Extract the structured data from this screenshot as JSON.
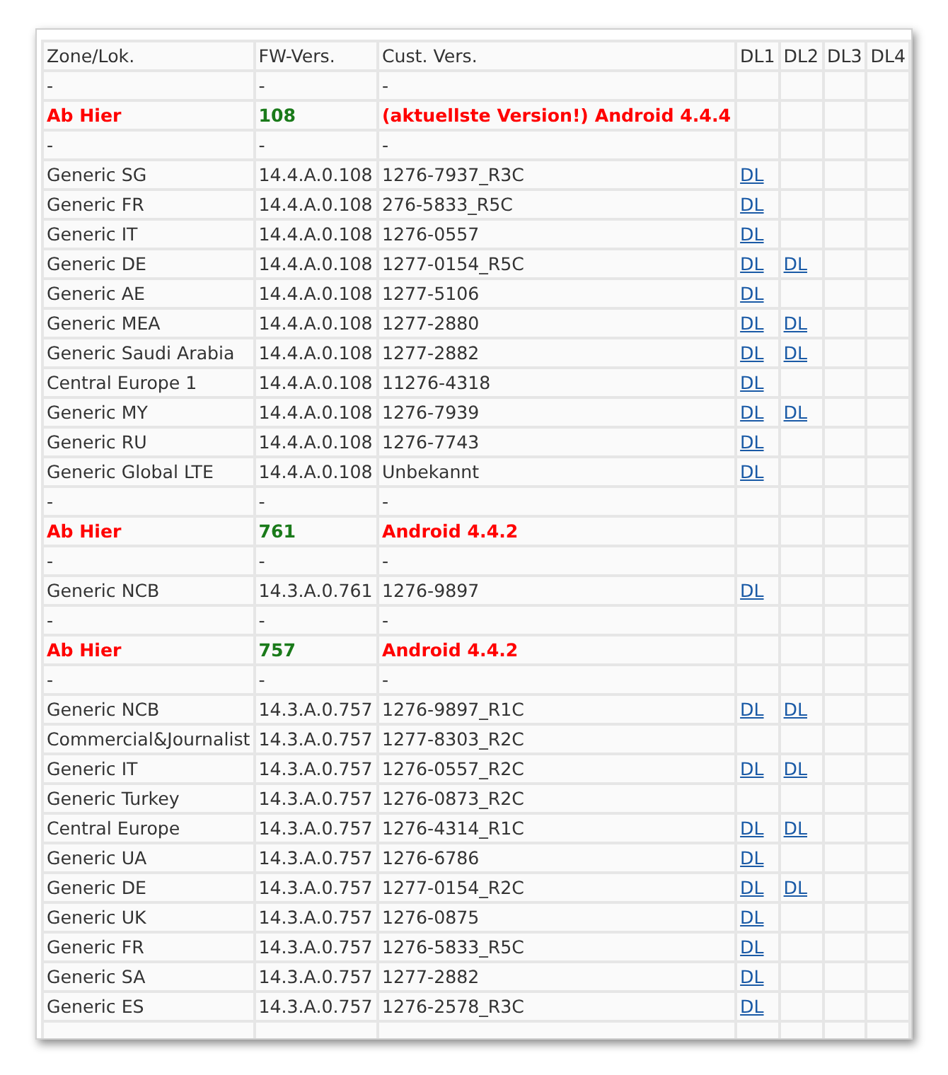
{
  "table": {
    "columns": [
      "Zone/Lok.",
      "FW-Vers.",
      "Cust. Vers.",
      "DL1",
      "DL2",
      "DL3",
      "DL4"
    ],
    "rows": [
      {
        "kind": "separator",
        "cells": [
          "-",
          "-",
          "-"
        ]
      },
      {
        "kind": "section",
        "cells": [
          "Ab Hier",
          "108",
          "(aktuellste Version!) Android 4.4.4"
        ]
      },
      {
        "kind": "separator",
        "cells": [
          "-",
          "-",
          "-"
        ]
      },
      {
        "kind": "data",
        "cells": [
          "Generic SG",
          "14.4.A.0.108",
          "1276-7937_R3C"
        ],
        "downloads": [
          "DL"
        ]
      },
      {
        "kind": "data",
        "cells": [
          "Generic FR",
          "14.4.A.0.108",
          "276-5833_R5C"
        ],
        "downloads": [
          "DL"
        ]
      },
      {
        "kind": "data",
        "cells": [
          "Generic IT",
          "14.4.A.0.108",
          "1276-0557"
        ],
        "downloads": [
          "DL"
        ]
      },
      {
        "kind": "data",
        "cells": [
          "Generic DE",
          "14.4.A.0.108",
          "1277-0154_R5C"
        ],
        "downloads": [
          "DL",
          "DL"
        ]
      },
      {
        "kind": "data",
        "cells": [
          "Generic AE",
          "14.4.A.0.108",
          "1277-5106"
        ],
        "downloads": [
          "DL"
        ]
      },
      {
        "kind": "data",
        "cells": [
          "Generic MEA",
          "14.4.A.0.108",
          "1277-2880"
        ],
        "downloads": [
          "DL",
          "DL"
        ]
      },
      {
        "kind": "data",
        "cells": [
          "Generic Saudi Arabia",
          "14.4.A.0.108",
          "1277-2882"
        ],
        "downloads": [
          "DL",
          "DL"
        ]
      },
      {
        "kind": "data",
        "cells": [
          "Central Europe 1",
          "14.4.A.0.108",
          "11276-4318"
        ],
        "downloads": [
          "DL"
        ]
      },
      {
        "kind": "data",
        "cells": [
          "Generic MY",
          "14.4.A.0.108",
          "1276-7939"
        ],
        "downloads": [
          "DL",
          "DL"
        ]
      },
      {
        "kind": "data",
        "cells": [
          "Generic RU",
          "14.4.A.0.108",
          "1276-7743"
        ],
        "downloads": [
          "DL"
        ]
      },
      {
        "kind": "data",
        "cells": [
          "Generic Global LTE",
          "14.4.A.0.108",
          "Unbekannt"
        ],
        "downloads": [
          "DL"
        ]
      },
      {
        "kind": "separator",
        "cells": [
          "-",
          "-",
          "-"
        ]
      },
      {
        "kind": "section",
        "cells": [
          "Ab Hier",
          "761",
          "Android 4.4.2"
        ]
      },
      {
        "kind": "separator",
        "cells": [
          "-",
          "-",
          "-"
        ]
      },
      {
        "kind": "data",
        "cells": [
          "Generic NCB",
          "14.3.A.0.761",
          "1276-9897"
        ],
        "downloads": [
          "DL"
        ]
      },
      {
        "kind": "separator",
        "cells": [
          "-",
          "-",
          "-"
        ]
      },
      {
        "kind": "section",
        "cells": [
          "Ab Hier",
          "757",
          "Android 4.4.2"
        ]
      },
      {
        "kind": "separator",
        "cells": [
          "-",
          "-",
          "-"
        ]
      },
      {
        "kind": "data",
        "cells": [
          "Generic NCB",
          "14.3.A.0.757",
          "1276-9897_R1C"
        ],
        "downloads": [
          "DL",
          "DL"
        ]
      },
      {
        "kind": "data",
        "cells": [
          "Commercial&Journalist",
          "14.3.A.0.757",
          "1277-8303_R2C"
        ]
      },
      {
        "kind": "data",
        "cells": [
          "Generic IT",
          "14.3.A.0.757",
          "1276-0557_R2C"
        ],
        "downloads": [
          "DL",
          "DL"
        ]
      },
      {
        "kind": "data",
        "cells": [
          "Generic Turkey",
          "14.3.A.0.757",
          "1276-0873_R2C"
        ]
      },
      {
        "kind": "data",
        "cells": [
          "Central Europe",
          "14.3.A.0.757",
          "1276-4314_R1C"
        ],
        "downloads": [
          "DL",
          "DL"
        ]
      },
      {
        "kind": "data",
        "cells": [
          "Generic UA",
          "14.3.A.0.757",
          "1276-6786"
        ],
        "downloads": [
          "DL"
        ]
      },
      {
        "kind": "data",
        "cells": [
          "Generic DE",
          "14.3.A.0.757",
          "1277-0154_R2C"
        ],
        "downloads": [
          "DL",
          "DL"
        ]
      },
      {
        "kind": "data",
        "cells": [
          "Generic UK",
          "14.3.A.0.757",
          "1276-0875"
        ],
        "downloads": [
          "DL"
        ]
      },
      {
        "kind": "data",
        "cells": [
          "Generic FR",
          "14.3.A.0.757",
          "1276-5833_R5C"
        ],
        "downloads": [
          "DL"
        ]
      },
      {
        "kind": "data",
        "cells": [
          "Generic SA",
          "14.3.A.0.757",
          "1277-2882"
        ],
        "downloads": [
          "DL"
        ]
      },
      {
        "kind": "data",
        "cells": [
          "Generic ES",
          "14.3.A.0.757",
          "1276-2578_R3C"
        ],
        "downloads": [
          "DL"
        ]
      }
    ]
  }
}
